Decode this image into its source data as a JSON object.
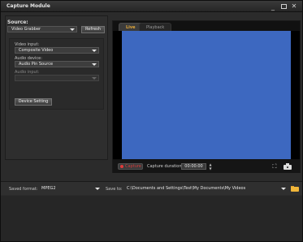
{
  "window": {
    "title": "Capture Module",
    "controls": {
      "minimize": "_",
      "close": "✕"
    }
  },
  "source": {
    "label": "Source:",
    "selected": "Video Grabber",
    "refresh_label": "Refresh"
  },
  "device": {
    "video_input_label": "Video input:",
    "video_input_value": "Composite Video",
    "audio_device_label": "Audio device:",
    "audio_device_value": "Audio Pin Source",
    "audio_input_label": "Audio input:",
    "audio_input_value": "",
    "device_setting_label": "Device Setting"
  },
  "preview": {
    "tabs": [
      {
        "label": "Live"
      },
      {
        "label": "Playback"
      }
    ],
    "video_color": "#3d68c0"
  },
  "capture": {
    "button_label": "Capture",
    "duration_label": "Capture duration:",
    "duration_value": "00:00:00",
    "spinner_up": "▲",
    "spinner_down": "▼",
    "expand_icon": "⛶"
  },
  "output": {
    "saved_format_label": "Saved format:",
    "saved_format_value": "MPEG2",
    "save_to_label": "Save to:",
    "save_to_value": "C:\\Documents and Settings\\Test\\My Documents\\My Videos"
  },
  "colors": {
    "accent_tab": "#e4a93a",
    "record_red": "#e03a3a",
    "folder": "#f0b63a"
  }
}
